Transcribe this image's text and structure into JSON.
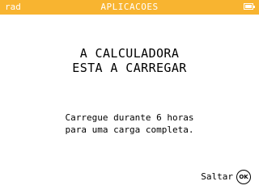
{
  "status_bar": {
    "mode": "rad",
    "title": "APLICACOES",
    "battery_icon": "battery-icon",
    "battery_level": 1.0,
    "background_color": "#f8b430"
  },
  "headline": {
    "line1": "A CALCULADORA",
    "line2": "ESTA A CARREGAR"
  },
  "message": {
    "line1": "Carregue durante 6 horas",
    "line2": "para uma carga completa."
  },
  "skip": {
    "label": "Saltar",
    "key_label": "OK",
    "key_icon": "ok-button-icon"
  }
}
